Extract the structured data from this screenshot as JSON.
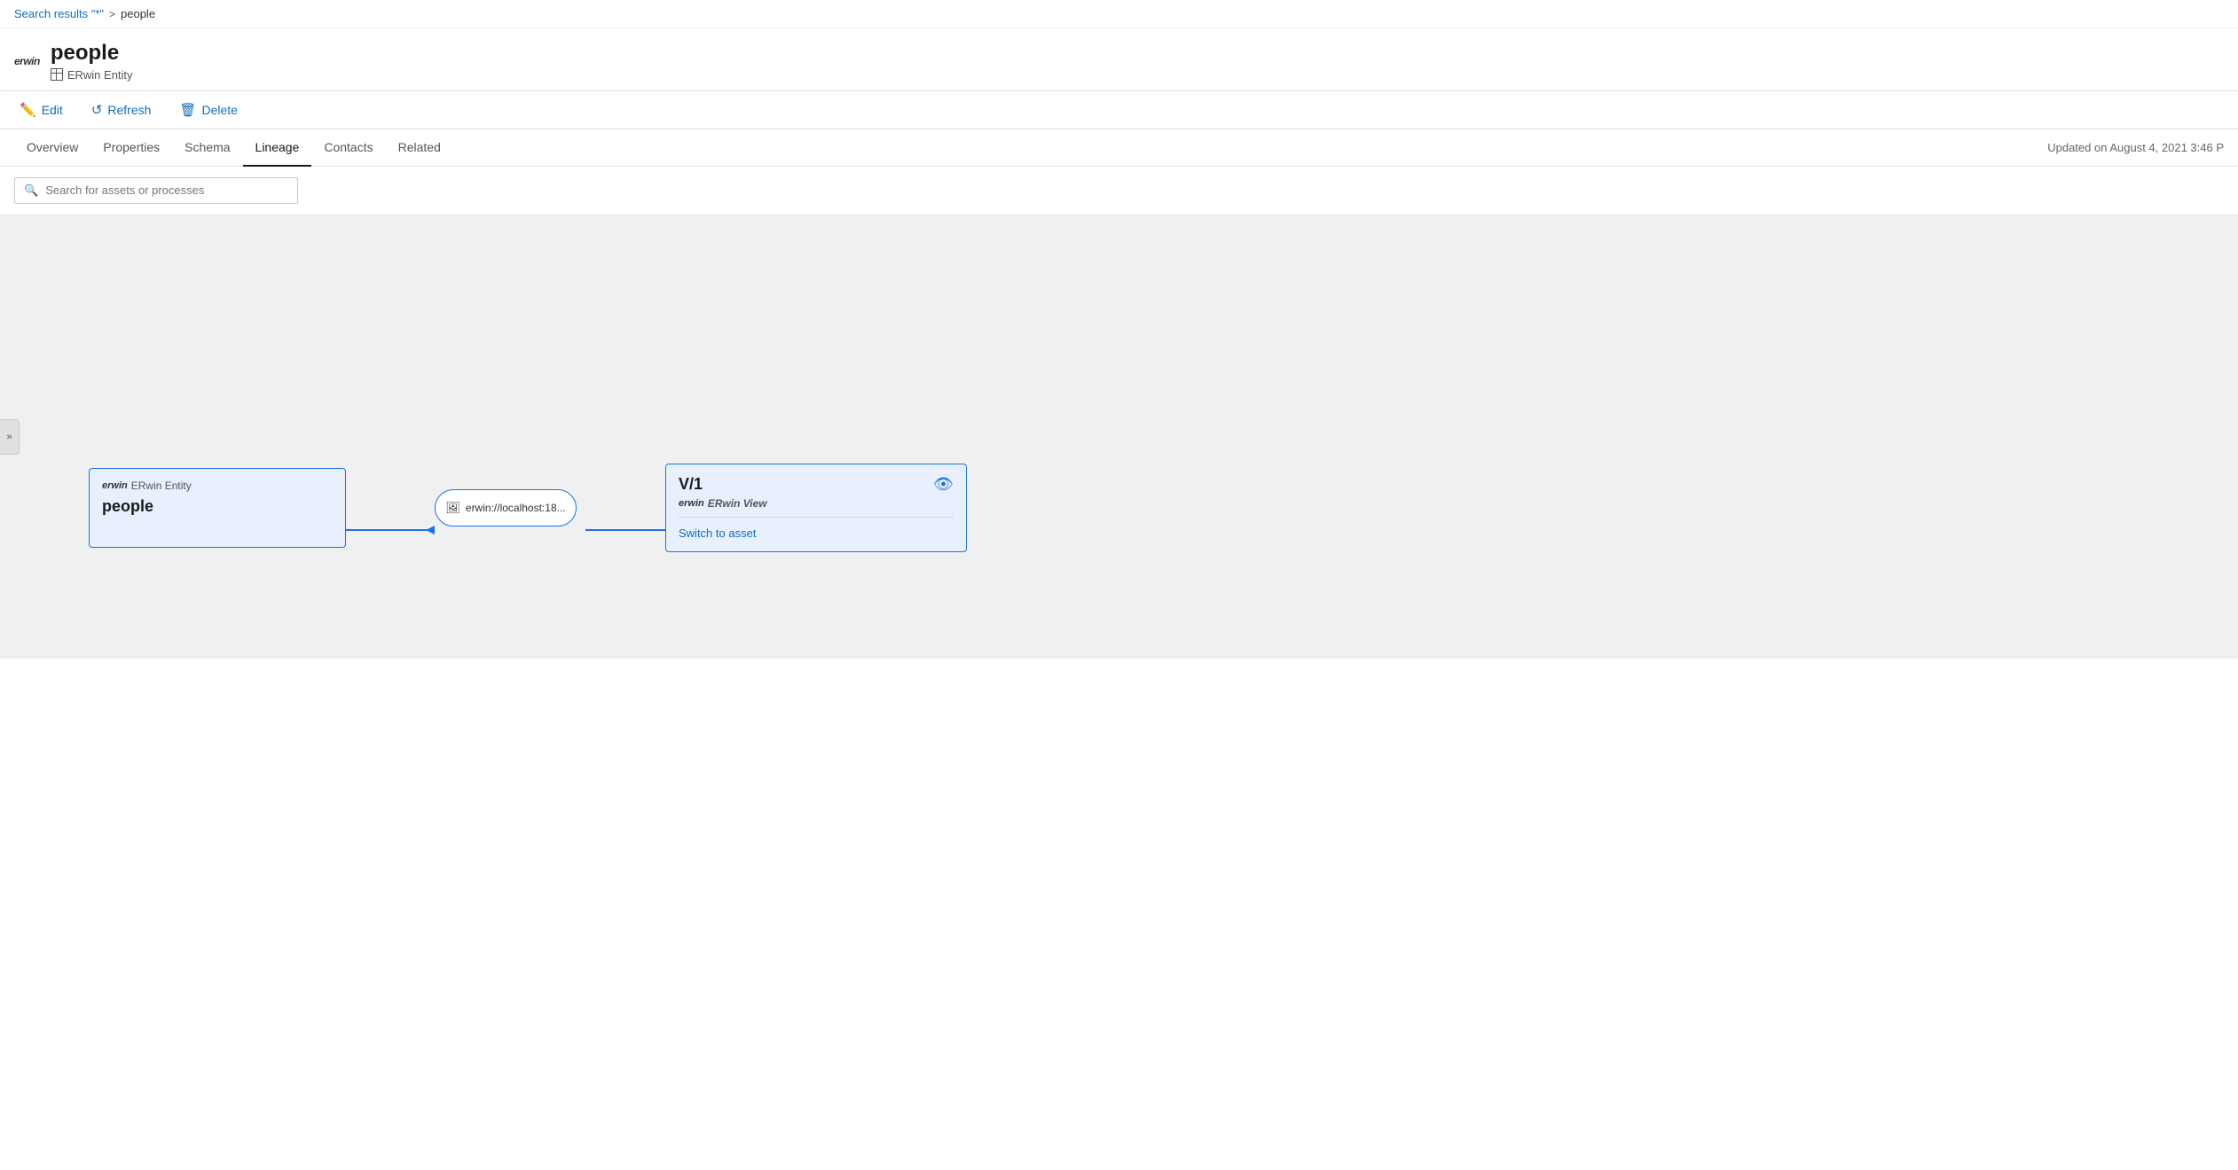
{
  "breadcrumb": {
    "search_link": "Search results \"*\"",
    "separator": ">",
    "current": "people"
  },
  "header": {
    "logo": "erwin",
    "title": "people",
    "subtitle": "ERwin Entity"
  },
  "toolbar": {
    "edit_label": "Edit",
    "refresh_label": "Refresh",
    "delete_label": "Delete"
  },
  "tabs": {
    "items": [
      {
        "id": "overview",
        "label": "Overview",
        "active": false
      },
      {
        "id": "properties",
        "label": "Properties",
        "active": false
      },
      {
        "id": "schema",
        "label": "Schema",
        "active": false
      },
      {
        "id": "lineage",
        "label": "Lineage",
        "active": true
      },
      {
        "id": "contacts",
        "label": "Contacts",
        "active": false
      },
      {
        "id": "related",
        "label": "Related",
        "active": false
      }
    ],
    "updated": "Updated on August 4, 2021 3:46 P"
  },
  "search": {
    "placeholder": "Search for assets or processes"
  },
  "lineage": {
    "source_node": {
      "brand": "erwin",
      "type": "ERwin Entity",
      "name": "people"
    },
    "process_node": {
      "label": "erwin://localhost:18..."
    },
    "target_node": {
      "name": "V/1",
      "brand": "erwin",
      "type": "ERwin View",
      "switch_link": "Switch to asset"
    }
  }
}
